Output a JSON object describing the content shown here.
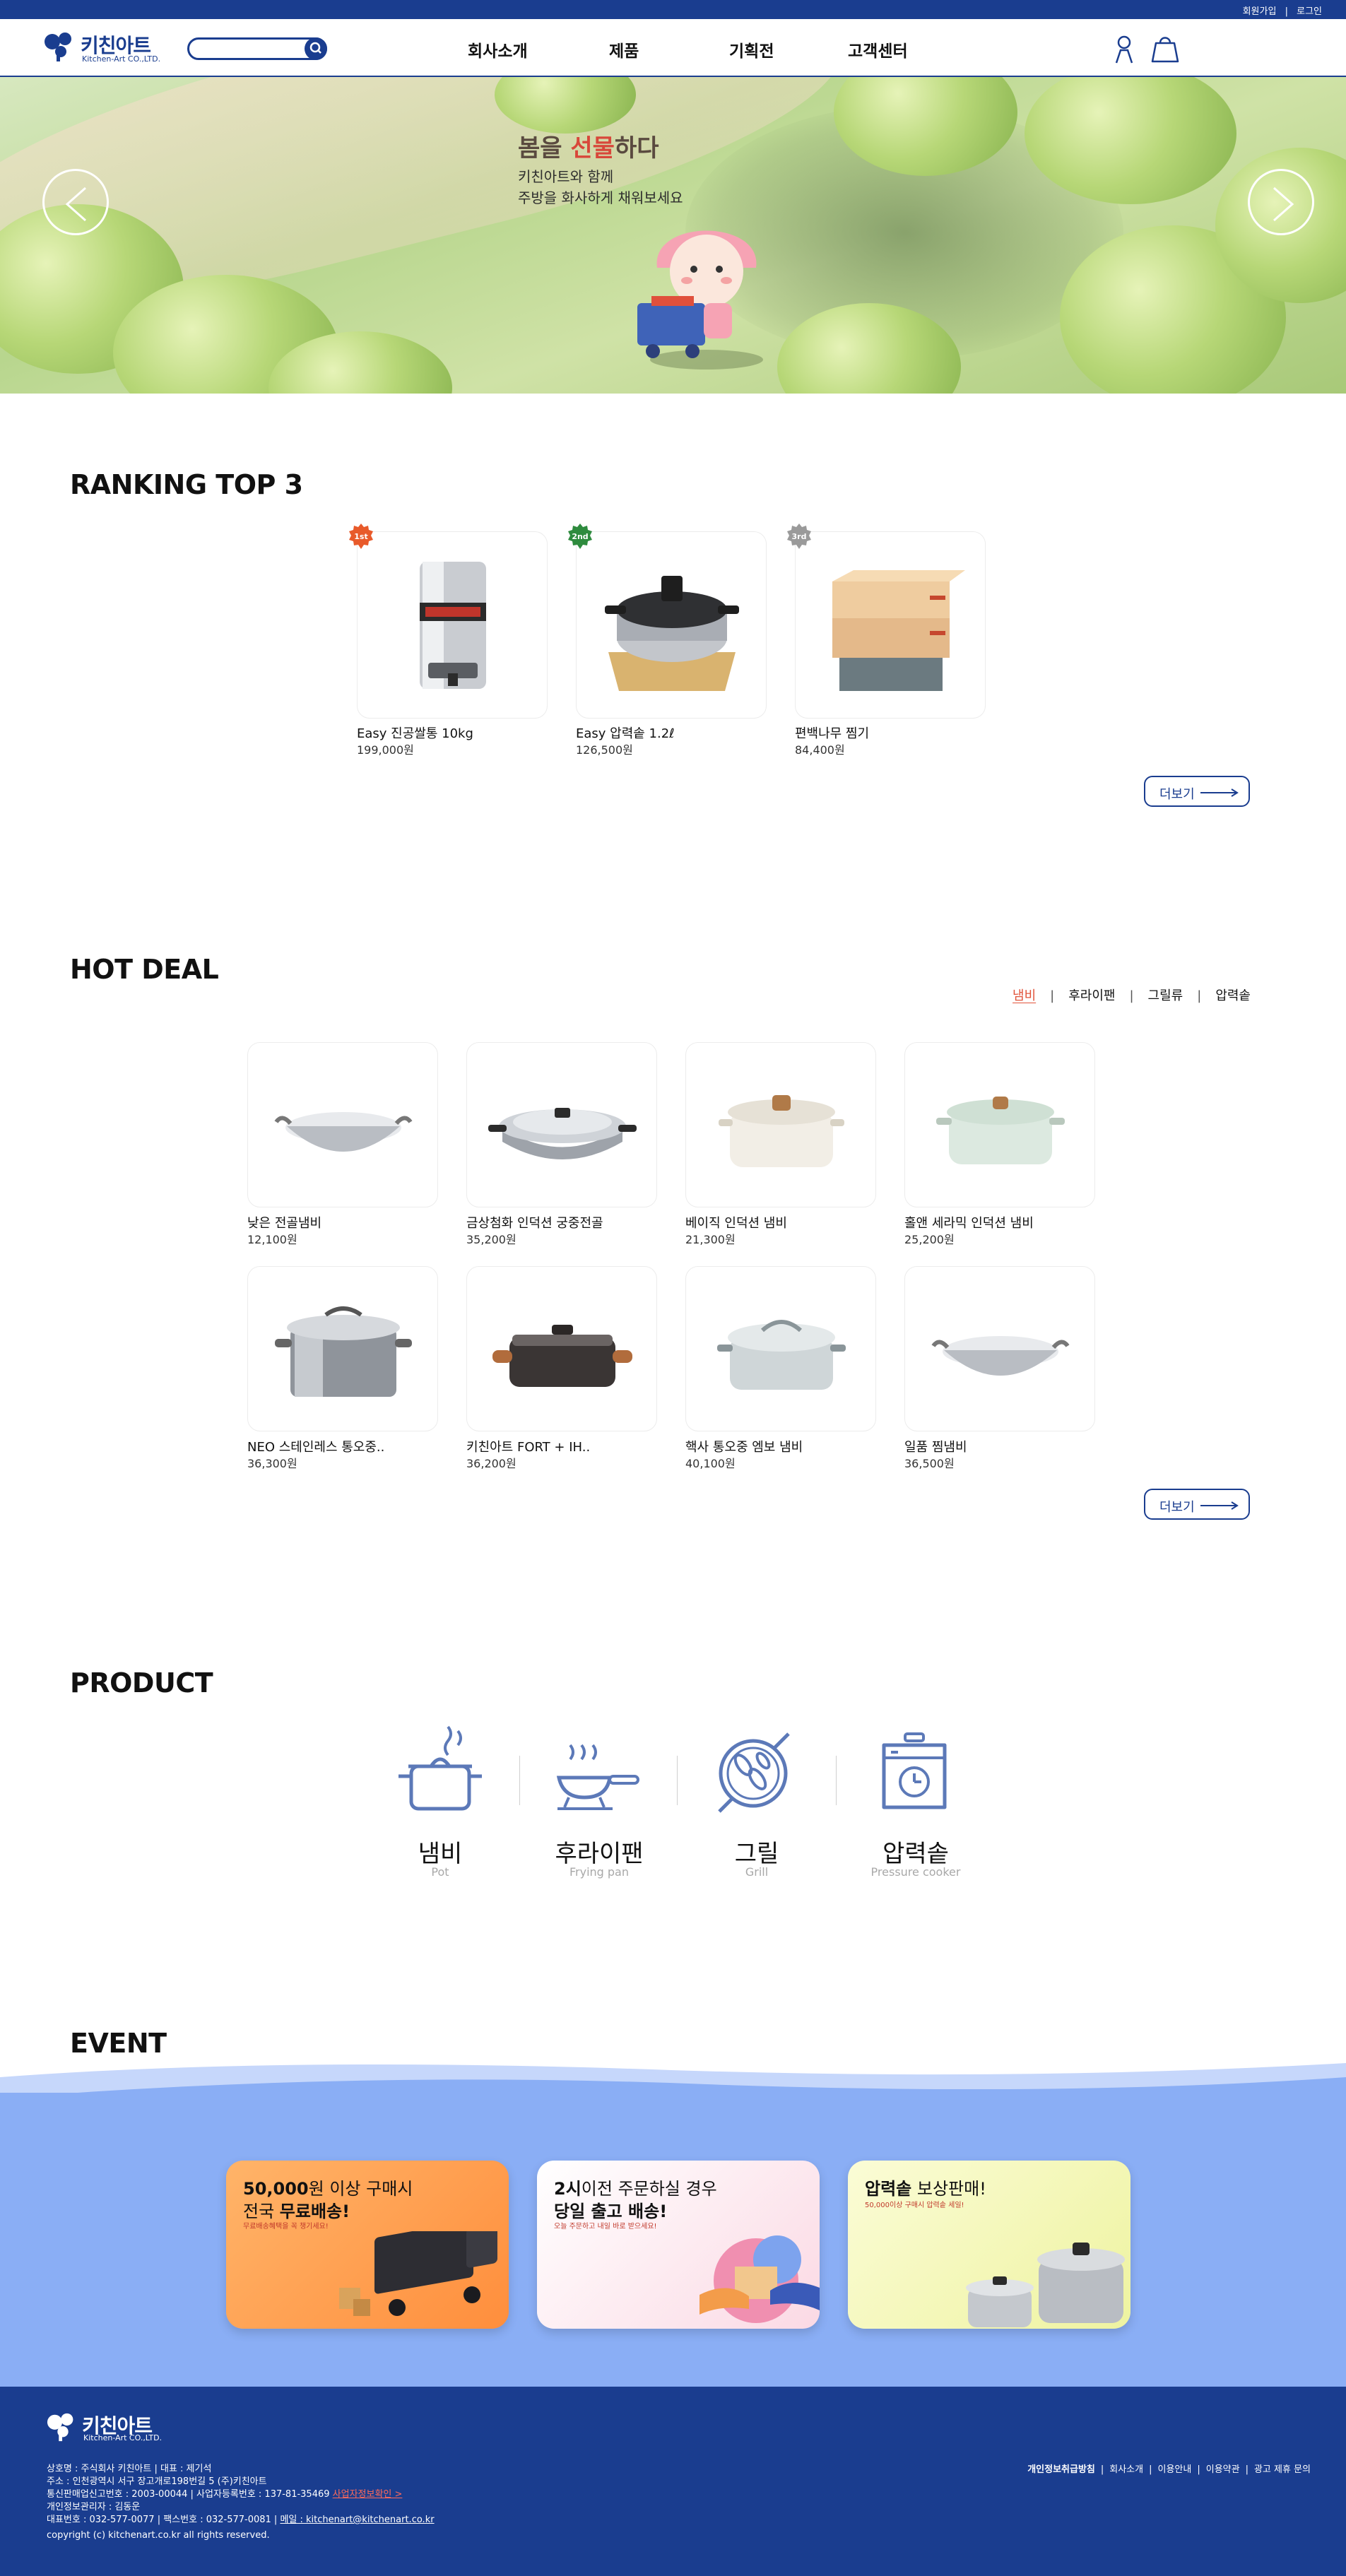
{
  "colors": {
    "brand": "#1a3d8f",
    "accent": "#e1533a",
    "event_bg": "#8aaef5"
  },
  "topbar": {
    "signup": "회원가입",
    "divider": "|",
    "login": "로그인"
  },
  "header": {
    "logo_name": "키친아트",
    "logo_sub": "Kitchen-Art CO.,LTD.",
    "search_placeholder": "",
    "nav": [
      "회사소개",
      "제품",
      "기획전",
      "고객센터"
    ],
    "icons": [
      "user-icon",
      "shopping-bag-icon"
    ]
  },
  "hero": {
    "title_prefix": "봄을 ",
    "title_highlight": "선물",
    "title_suffix": "하다",
    "subtitle_line1": "키친아트와 함께",
    "subtitle_line2": "주방을 화사하게 채워보세요"
  },
  "ranking": {
    "title": "RANKING TOP 3",
    "items": [
      {
        "badge": "1st",
        "badge_color": "#e85a2a",
        "name": "Easy 진공쌀통 10kg",
        "price": "199,000원"
      },
      {
        "badge": "2nd",
        "badge_color": "#2e8b3e",
        "name": "Easy 압력솥 1.2ℓ",
        "price": "126,500원"
      },
      {
        "badge": "3rd",
        "badge_color": "#9a9a9a",
        "name": "편백나무 찜기",
        "price": "84,400원"
      }
    ],
    "more": "더보기"
  },
  "hotdeal": {
    "title": "HOT DEAL",
    "tabs": [
      "냄비",
      "후라이팬",
      "그릴류",
      "압력솥"
    ],
    "active_tab": 0,
    "items": [
      {
        "name": "낮은 전골냄비",
        "price": "12,100원"
      },
      {
        "name": "금상첨화 인덕션 궁중전골",
        "price": "35,200원"
      },
      {
        "name": "베이직 인덕션 냄비",
        "price": "21,300원"
      },
      {
        "name": "홀앤 세라믹 인덕션 냄비",
        "price": "25,200원"
      },
      {
        "name": "NEO 스테인레스 통오중..",
        "price": "36,300원"
      },
      {
        "name": "키친아트 FORT + IH..",
        "price": "36,200원"
      },
      {
        "name": "핵사 통오중 엠보 냄비",
        "price": "40,100원"
      },
      {
        "name": "일품 찜냄비",
        "price": "36,500원"
      }
    ],
    "more": "더보기"
  },
  "product": {
    "title": "PRODUCT",
    "categories": [
      {
        "ko": "냄비",
        "en": "Pot",
        "icon": "pot-icon"
      },
      {
        "ko": "후라이팬",
        "en": "Frying pan",
        "icon": "frying-pan-icon"
      },
      {
        "ko": "그릴",
        "en": "Grill",
        "icon": "grill-icon"
      },
      {
        "ko": "압력솥",
        "en": "Pressure cooker",
        "icon": "pressure-cooker-icon"
      }
    ]
  },
  "event": {
    "title": "EVENT",
    "cards": [
      {
        "l1_bold": "50,000",
        "l1_rest": "원 이상 구매시",
        "l2_a": "전국 ",
        "l2_b": "무료배송!",
        "l3": "무료배송혜택을 꼭 챙기세요!",
        "bg": "#ffa352"
      },
      {
        "l1_bold": "2시",
        "l1_rest": "이전 주문하실 경우",
        "l2_a": "당일 출고 배송!",
        "l2_b": "",
        "l3": "오늘 주문하고 내일 바로 받으세요!",
        "bg": "#fde8ee"
      },
      {
        "l1_bold": "압력솥",
        "l1_rest": " 보상판매!",
        "l2_a": "",
        "l2_b": "",
        "l3": "50,000이상 구매시 압력솥 세일!",
        "bg": "#f5f7b8"
      }
    ]
  },
  "footer": {
    "logo_name": "키친아트",
    "logo_sub": "Kitchen-Art CO.,LTD.",
    "info": [
      "상호명 : 주식회사 키친아트  |  대표 : 제기석",
      "주소 : 인천광역시 서구 장고개로198번길 5 (주)키친아트",
      "통신판매업신고번호 : 2003-00044  |  사업자등록번호 : 137-81-35469",
      "개인정보관리자 : 김동운",
      "대표번호 : 032-577-0077 | 팩스번호 : 032-577-0081 | "
    ],
    "biz_check": "사업자정보확인 >",
    "email": "메일 : kitchenart@kitchenart.co.kr",
    "copyright": "copyright (c) kitchenart.co.kr all rights reserved.",
    "links": [
      "개인정보취급방침",
      "회사소개",
      "이용안내",
      "이용약관",
      "광고 제휴 문의"
    ]
  }
}
